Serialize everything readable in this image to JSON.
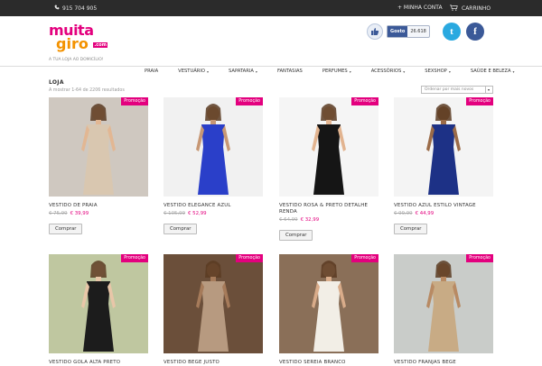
{
  "topbar": {
    "phone": "915 704 905",
    "account": "+ MINHA CONTA",
    "cart": "CARRINHO"
  },
  "header": {
    "logo_line1": "muita",
    "logo_line2": "giro",
    "logo_badge": ".com",
    "tagline": "A TUA LOJA AO DOMICÍLIO!",
    "fb_label": "Gosto",
    "fb_count": "26.618"
  },
  "nav": [
    {
      "label": "PRAIA",
      "dropdown": false
    },
    {
      "label": "VESTUÁRIO",
      "dropdown": true
    },
    {
      "label": "SAPATARIA",
      "dropdown": true
    },
    {
      "label": "FANTASIAS",
      "dropdown": false
    },
    {
      "label": "PERFUMES",
      "dropdown": true
    },
    {
      "label": "ACESSÓRIOS",
      "dropdown": true
    },
    {
      "label": "SEXSHOP",
      "dropdown": true
    },
    {
      "label": "SAÚDE E BELEZA",
      "dropdown": true
    }
  ],
  "shop": {
    "title": "LOJA",
    "result_count": "A mostrar 1-64 de 2206 resultados",
    "ordering": "Ordenar por mais novos",
    "promo_label": "Promoção",
    "buy_label": "Comprar"
  },
  "products": [
    {
      "title": "VESTIDO DE PRAIA",
      "old": "€ 75,99",
      "new": "€ 39,99",
      "bg": "#cfc8c0",
      "dress": "#d9c7b0",
      "skin": "#e2b793"
    },
    {
      "title": "VESTIDO ELEGANCE AZUL",
      "old": "€ 105,99",
      "new": "€ 52,99",
      "bg": "#f1f1f1",
      "dress": "#2a3fc9",
      "skin": "#c79774"
    },
    {
      "title": "VESTIDO ROSA & PRETO DETALHE RENDA",
      "old": "€ 64,99",
      "new": "€ 32,99",
      "bg": "#f5f5f5",
      "dress": "#151515",
      "skin": "#e2b490"
    },
    {
      "title": "VESTIDO AZUL ESTILO VINTAGE",
      "old": "€ 99,99",
      "new": "€ 44,99",
      "bg": "#f4f4f4",
      "dress": "#1d3186",
      "skin": "#9b6b48"
    },
    {
      "title": "VESTIDO GOLA ALTA PRETO",
      "old": "",
      "new": "",
      "bg": "#bfc7a0",
      "dress": "#1c1c1c",
      "skin": "#e8c6a8"
    },
    {
      "title": "VESTIDO BEGE JUSTO",
      "old": "",
      "new": "",
      "bg": "#6b4f3a",
      "dress": "#b79a80",
      "skin": "#a67b5a"
    },
    {
      "title": "VESTIDO SEREIA BRANCO",
      "old": "",
      "new": "",
      "bg": "#8a6f58",
      "dress": "#f2eee6",
      "skin": "#d9ac8a"
    },
    {
      "title": "VESTIDO FRANJAS BEGE",
      "old": "",
      "new": "",
      "bg": "#c9ccc9",
      "dress": "#c8ab85",
      "skin": "#b88a63"
    }
  ]
}
